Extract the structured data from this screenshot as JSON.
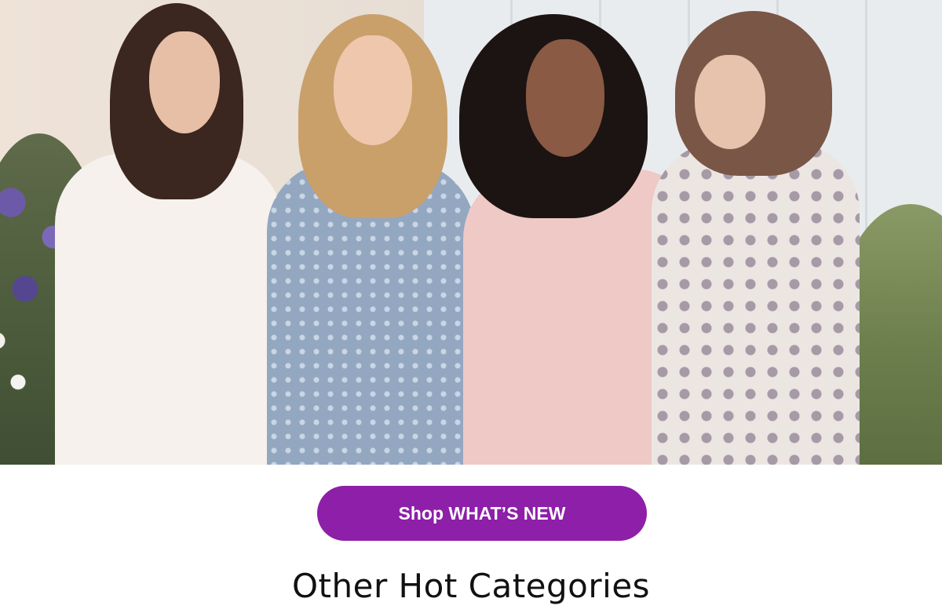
{
  "hero": {
    "image_alt": "Four women smiling wearing spring tops",
    "colors": {
      "background": "#ece6e0",
      "accent": "#8d1fa8"
    }
  },
  "cta": {
    "label": "Shop WHAT’S NEW"
  },
  "section": {
    "heading": "Other Hot Categories"
  }
}
